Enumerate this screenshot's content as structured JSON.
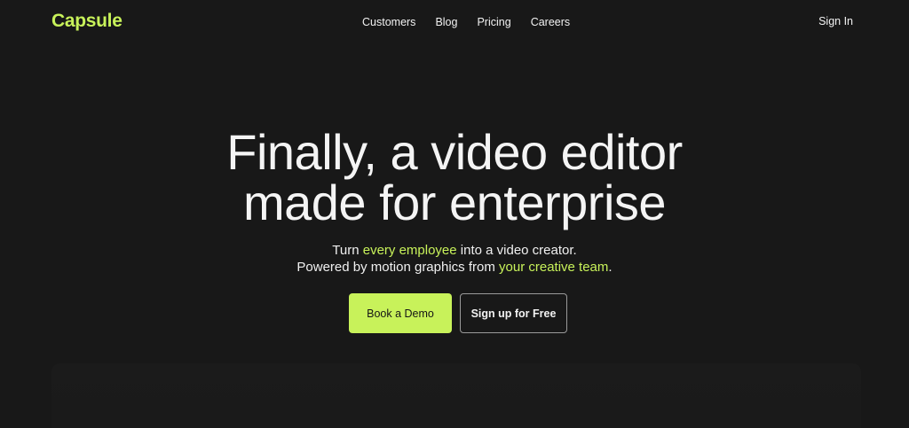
{
  "header": {
    "logo": "Capsule",
    "nav": [
      {
        "label": "Customers"
      },
      {
        "label": "Blog"
      },
      {
        "label": "Pricing"
      },
      {
        "label": "Careers"
      }
    ],
    "sign_in": "Sign In"
  },
  "hero": {
    "title_line1": "Finally, a video editor",
    "title_line2": "made for enterprise",
    "subtitle_line1_prefix": "Turn ",
    "subtitle_line1_highlight": "every employee",
    "subtitle_line1_suffix": " into a video creator.",
    "subtitle_line2_prefix": "Powered by motion graphics from ",
    "subtitle_line2_highlight": "your creative team",
    "subtitle_line2_suffix": "."
  },
  "cta": {
    "primary": "Book a Demo",
    "secondary": "Sign up for Free"
  },
  "colors": {
    "background": "#181818",
    "accent": "#c8f25a",
    "text": "#f2f2f2"
  }
}
